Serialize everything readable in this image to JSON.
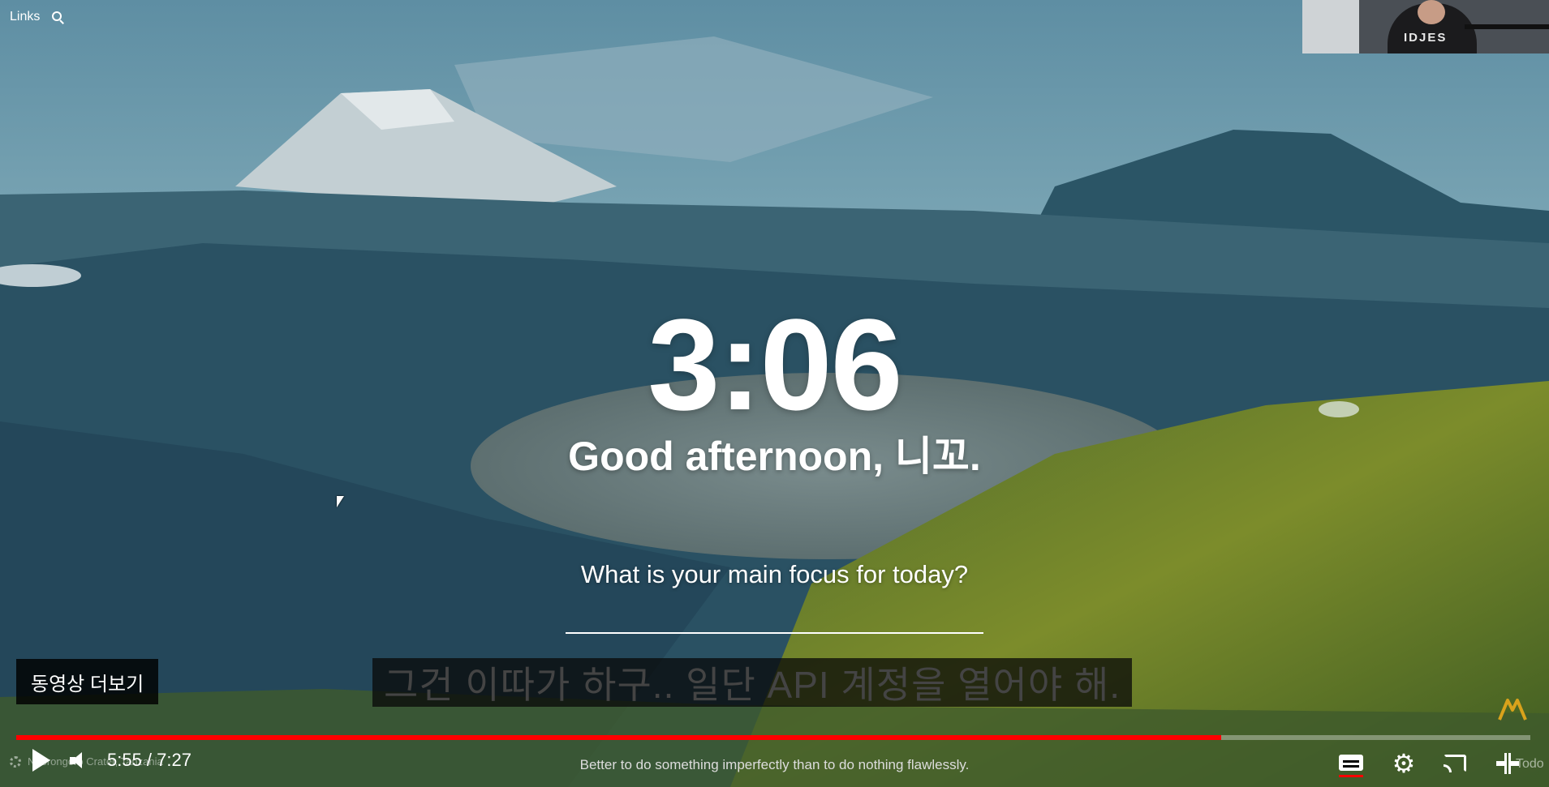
{
  "top_left": {
    "links_label": "Links",
    "search_icon": "search-icon"
  },
  "webcam": {
    "shirt_text": "IDJES"
  },
  "dashboard": {
    "time": "3:06",
    "greeting": "Good afternoon, 니꼬.",
    "focus_question": "What is your main focus for today?",
    "focus_value": ""
  },
  "overlay": {
    "more_videos": "동영상 더보기",
    "caption": "그건 이따가 하구.. 일단 API 계정을 열어야 해."
  },
  "player": {
    "current_time": "5:55",
    "duration": "7:27",
    "time_display": "5:55 / 7:27",
    "progress_fraction": 0.796,
    "progress_color": "#ff0000",
    "icons": [
      "play-icon",
      "volume-icon",
      "captions-icon",
      "settings-icon",
      "cast-icon",
      "exit-fullscreen-icon"
    ]
  },
  "bottom": {
    "quote": "Better to do something imperfectly than to do nothing flawlessly.",
    "location_faint": "Ngorongoro Crater, Tanzania",
    "todo_label": "Todo"
  }
}
